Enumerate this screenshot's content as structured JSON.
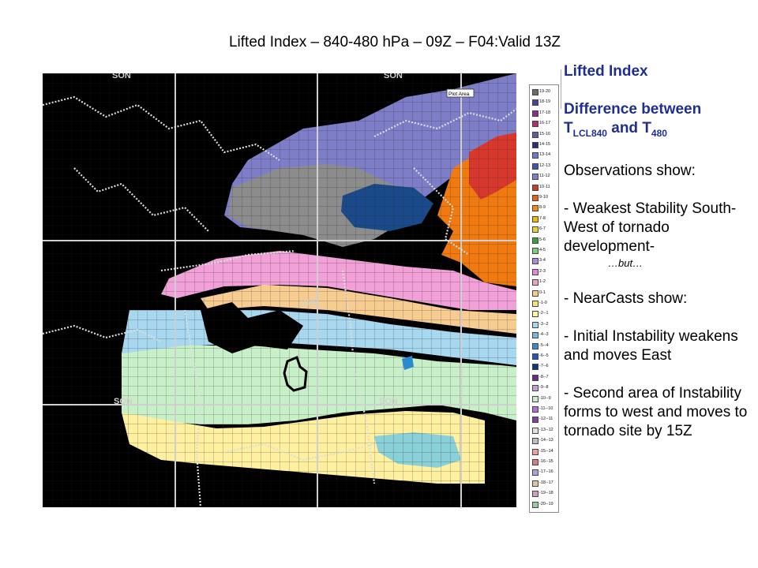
{
  "title": "Lifted Index – 840-480 hPa – 09Z – F04:Valid 13Z",
  "legend": {
    "plot_area_label": "Plot Area",
    "items": [
      {
        "label": "19-20",
        "color": "#6a6a6a"
      },
      {
        "label": "18-19",
        "color": "#4b3f9e"
      },
      {
        "label": "17-18",
        "color": "#8b2d8a"
      },
      {
        "label": "16-17",
        "color": "#b0306a"
      },
      {
        "label": "15-16",
        "color": "#5e5e9e"
      },
      {
        "label": "14-15",
        "color": "#2d2d7a"
      },
      {
        "label": "13-14",
        "color": "#6a7ac8"
      },
      {
        "label": "12-13",
        "color": "#3a5ab0"
      },
      {
        "label": "11-12",
        "color": "#7f7fc8"
      },
      {
        "label": "10-11",
        "color": "#c83c2c"
      },
      {
        "label": "9-10",
        "color": "#e8601a"
      },
      {
        "label": "8-9",
        "color": "#f28a14"
      },
      {
        "label": "7-8",
        "color": "#f5b800"
      },
      {
        "label": "6-7",
        "color": "#e8d23a"
      },
      {
        "label": "5-6",
        "color": "#3ca03c"
      },
      {
        "label": "4-5",
        "color": "#7ad07a"
      },
      {
        "label": "3-4",
        "color": "#b08ad8"
      },
      {
        "label": "2-3",
        "color": "#e08ad8"
      },
      {
        "label": "1-2",
        "color": "#f2a0c8"
      },
      {
        "label": "0-1",
        "color": "#f7cc90"
      },
      {
        "label": "-1-0",
        "color": "#f5e080"
      },
      {
        "label": "-2--1",
        "color": "#fff6a0"
      },
      {
        "label": "-3--2",
        "color": "#a8d8f0"
      },
      {
        "label": "-4--3",
        "color": "#7ab8e0"
      },
      {
        "label": "-5--4",
        "color": "#3a8ad0"
      },
      {
        "label": "-6--5",
        "color": "#1a5ab0"
      },
      {
        "label": "-7--6",
        "color": "#0a3a7a"
      },
      {
        "label": "-8--7",
        "color": "#6a2a8a"
      },
      {
        "label": "-9--8",
        "color": "#c0a0e0"
      },
      {
        "label": "-10--9",
        "color": "#c8ecc8"
      },
      {
        "label": "-11--10",
        "color": "#b070d0"
      },
      {
        "label": "-12--11",
        "color": "#7f3fa0"
      },
      {
        "label": "-13--12",
        "color": "#e0e0e0"
      },
      {
        "label": "-14--13",
        "color": "#c0c0c0"
      },
      {
        "label": "-15--14",
        "color": "#f0a0a0"
      },
      {
        "label": "-16--15",
        "color": "#d08080"
      },
      {
        "label": "-17--16",
        "color": "#a8a8d8"
      },
      {
        "label": "-18--17",
        "color": "#d8c8a8"
      },
      {
        "label": "-19--18",
        "color": "#c8a0c8"
      },
      {
        "label": "-20--19",
        "color": "#a0c8a0"
      }
    ]
  },
  "map": {
    "site_labels": [
      "SON",
      "SON",
      "COE",
      "SON",
      "SON"
    ],
    "colors": {
      "background": "#000000",
      "grid": "#ffffff",
      "borders": "#d9d9d9",
      "purple_band": "#7e7ec8",
      "gray": "#8c8c8c",
      "dark_blue": "#1a4a8a",
      "orange": "#f07a10",
      "red": "#d8382c",
      "pink": "#f2a0d8",
      "lavender": "#c8a0f0",
      "peach": "#f7cc90",
      "light_blue": "#a8d8f0",
      "mint": "#c8f0c8",
      "yellow": "#fff0a0",
      "teal": "#8ad0d8"
    }
  },
  "panel": {
    "heading": "Lifted Index",
    "diff_line": "Difference between",
    "t_symbol": "T",
    "lcl_sub": "LCL",
    "sub_840": "840",
    "and_word": " and ",
    "sub_480": "480",
    "obs": "Observations show:",
    "b1": "- Weakest Stability South-West of tornado development-",
    "but": "…but…",
    "b2": "- NearCasts show:",
    "b3": "- Initial Instability weakens and moves East",
    "b4": "- Second area of Instability forms to west and moves to tornado site by 15Z"
  }
}
